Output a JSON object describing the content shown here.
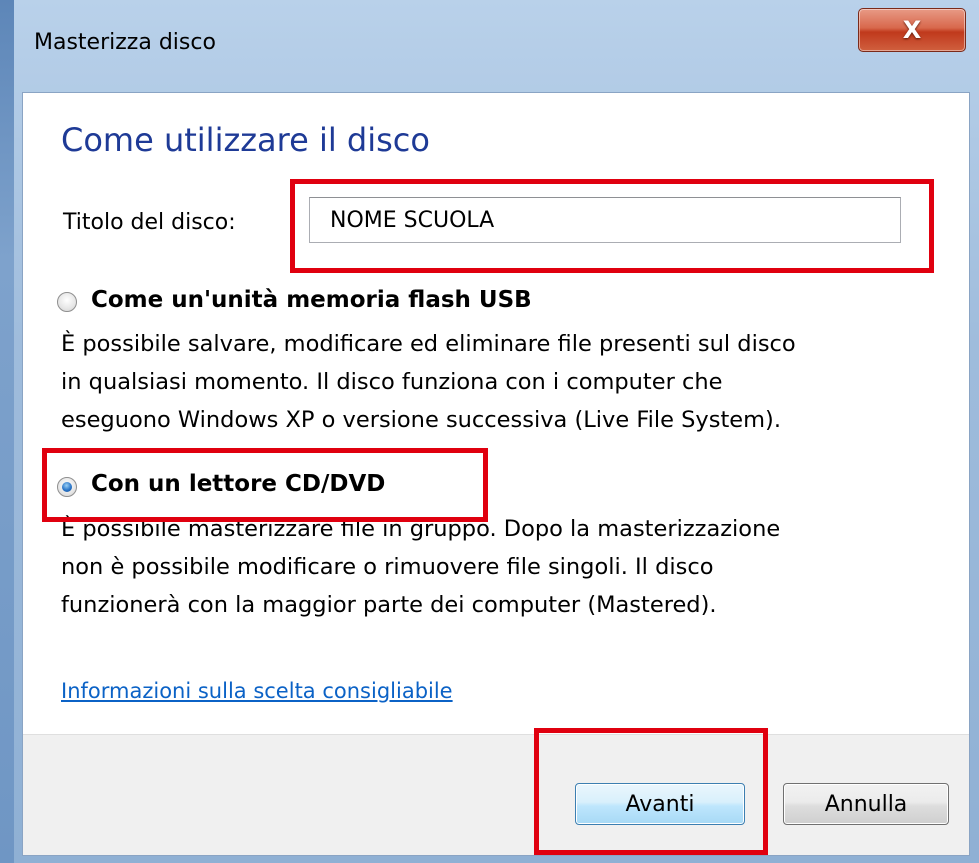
{
  "window": {
    "title": "Masterizza disco",
    "close_glyph": "X"
  },
  "dialog": {
    "heading": "Come utilizzare il disco",
    "title_label": "Titolo del disco:",
    "title_value": "NOME SCUOLA"
  },
  "options": [
    {
      "title": "Come un'unità memoria flash USB",
      "selected": false,
      "lines": [
        "È possibile salvare, modificare ed eliminare file presenti sul disco",
        "in qualsiasi momento. Il disco funziona con i computer che",
        "eseguono Windows XP o versione successiva (Live File System)."
      ]
    },
    {
      "title": "Con un lettore CD/DVD",
      "selected": true,
      "lines": [
        "È possibile masterizzare file in gruppo. Dopo la masterizzazione",
        "non è possibile modificare o rimuovere file singoli. Il disco",
        "funzionerà con la maggior parte dei computer (Mastered)."
      ]
    }
  ],
  "help_link": "Informazioni sulla scelta consigliabile",
  "buttons": {
    "next": "Avanti",
    "cancel": "Annulla"
  },
  "colors": {
    "heading": "#1e3a96",
    "link": "#0b62c6",
    "highlight": "#e0000f",
    "footer": "#f0f0f0"
  },
  "icons": {
    "close": "close-icon",
    "radio_unchecked": "radio-unchecked-icon",
    "radio_checked": "radio-checked-icon"
  }
}
